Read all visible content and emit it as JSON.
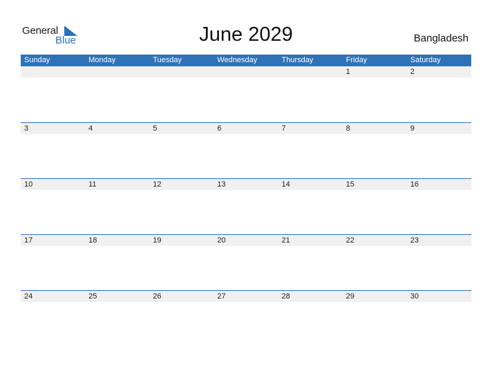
{
  "logo": {
    "part1": "General",
    "part2": "Blue"
  },
  "title": "June 2029",
  "country": "Bangladesh",
  "accent_color": "#2e72b8",
  "weekdays": [
    "Sunday",
    "Monday",
    "Tuesday",
    "Wednesday",
    "Thursday",
    "Friday",
    "Saturday"
  ],
  "weeks": [
    [
      "",
      "",
      "",
      "",
      "",
      "1",
      "2"
    ],
    [
      "3",
      "4",
      "5",
      "6",
      "7",
      "8",
      "9"
    ],
    [
      "10",
      "11",
      "12",
      "13",
      "14",
      "15",
      "16"
    ],
    [
      "17",
      "18",
      "19",
      "20",
      "21",
      "22",
      "23"
    ],
    [
      "24",
      "25",
      "26",
      "27",
      "28",
      "29",
      "30"
    ]
  ]
}
